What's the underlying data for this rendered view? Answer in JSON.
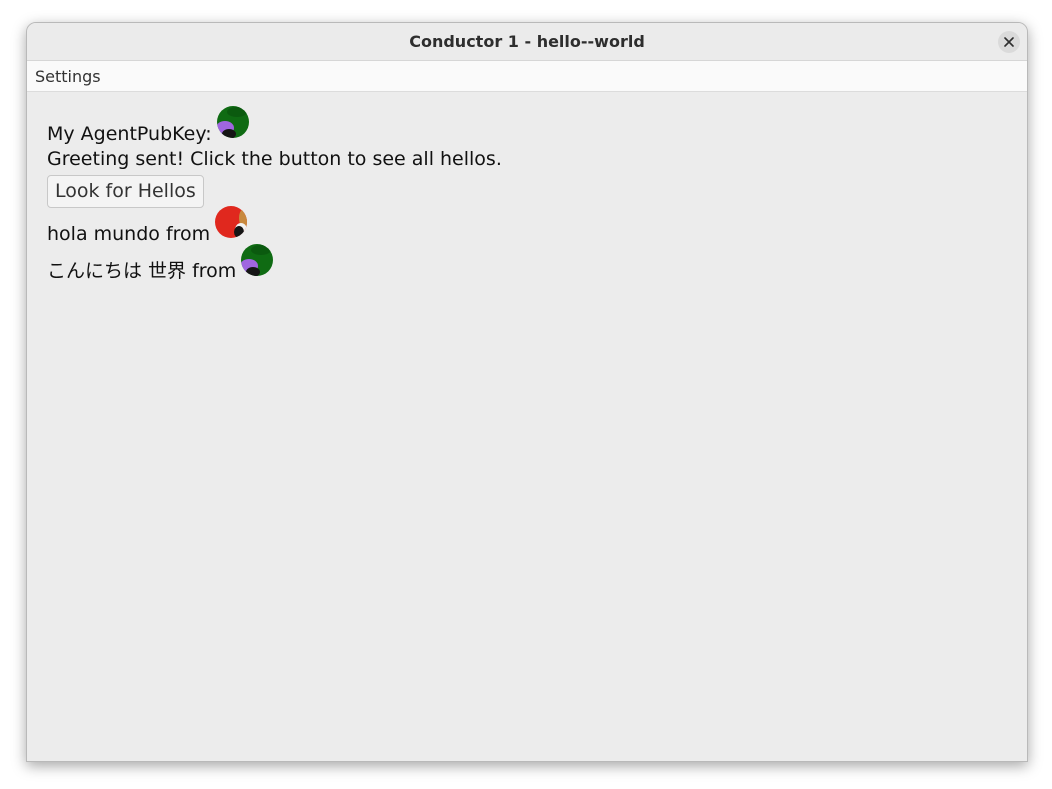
{
  "window": {
    "title": "Conductor 1 - hello--world"
  },
  "menu": {
    "settings_label": "Settings"
  },
  "content": {
    "agent_key_label": "My AgentPubKey:",
    "greeting_status": "Greeting sent! Click the button to see all hellos.",
    "look_button_label": "Look for Hellos",
    "hellos": [
      {
        "text": "hola mundo from",
        "avatar": "identicon-red"
      },
      {
        "text": "こんにちは 世界 from",
        "avatar": "identicon-green"
      }
    ]
  },
  "colors": {
    "identicon_green": "#0f6b13",
    "identicon_purple": "#a066e0",
    "identicon_red": "#e0281e",
    "identicon_tan": "#c8893e",
    "identicon_dark": "#151515"
  }
}
